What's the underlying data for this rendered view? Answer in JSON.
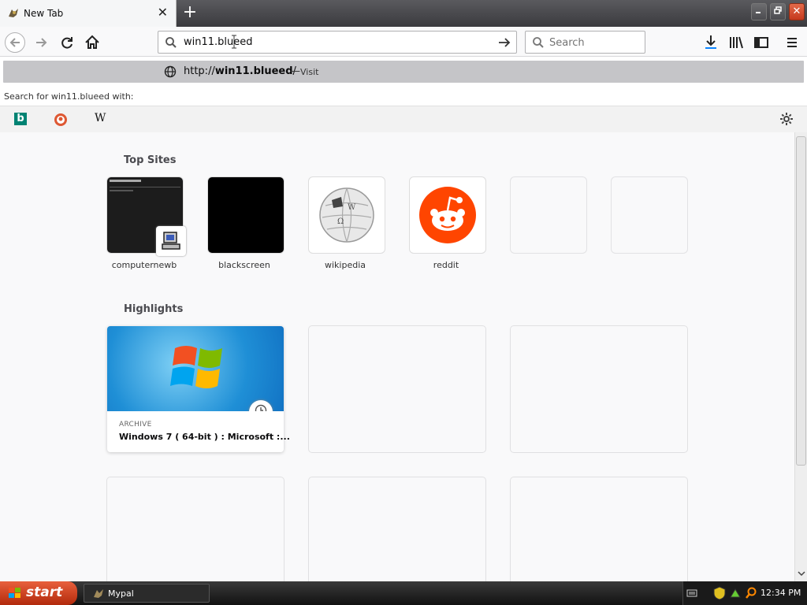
{
  "tab": {
    "title": "New Tab",
    "close": "✕",
    "new_tab": "+"
  },
  "window": {
    "minimize": "_",
    "restore": "❐",
    "close": "✕"
  },
  "navbar": {
    "url_value": "win11.blueed",
    "search_placeholder": "Search"
  },
  "dropdown": {
    "suggestion_prefix": "http://",
    "suggestion_host": "win11.blueed",
    "suggestion_suffix": "/",
    "suggestion_dash": "—",
    "suggestion_action": "Visit",
    "search_with": "Search for win11.blueed with:",
    "engines": [
      {
        "name": "bing-icon",
        "glyph": "b"
      },
      {
        "name": "duckduckgo-icon",
        "glyph": ""
      },
      {
        "name": "wikipedia-icon",
        "glyph": "W"
      }
    ]
  },
  "content": {
    "top_sites_title": "Top Sites",
    "top_sites": [
      {
        "label": "computernewb"
      },
      {
        "label": "blackscreen"
      },
      {
        "label": "wikipedia"
      },
      {
        "label": "reddit"
      },
      {
        "label": ""
      },
      {
        "label": ""
      }
    ],
    "highlights_title": "Highlights",
    "highlight_card": {
      "source": "ARCHIVE",
      "title": "Windows 7 ( 64-bit ) : Microsoft :..."
    }
  },
  "taskbar": {
    "start_label": "start",
    "task_label": "Mypal",
    "clock": "12:34 PM"
  },
  "colors": {
    "accent": "#0a84ff",
    "reddit": "#ff4500",
    "start": "#d9481f",
    "bing": "#008373"
  }
}
